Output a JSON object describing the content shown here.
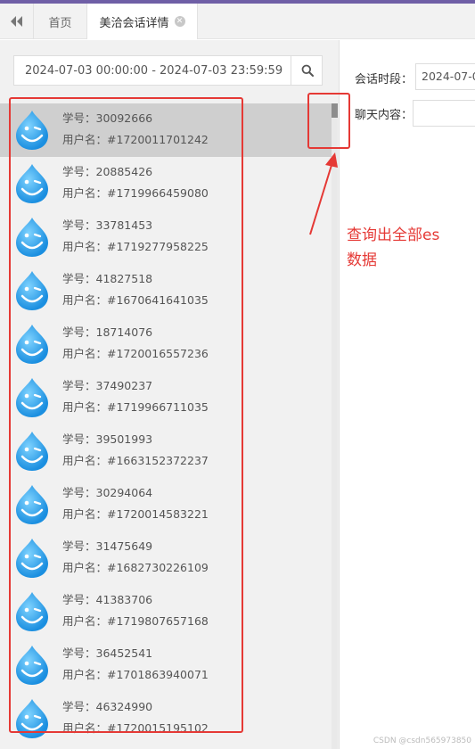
{
  "tabs": {
    "back_icon": "double-left-arrow",
    "home": "首页",
    "active": "美洽会话详情"
  },
  "search": {
    "value": "2024-07-03 00:00:00 - 2024-07-03 23:59:59"
  },
  "list": {
    "items": [
      {
        "id_label": "学号：30092666",
        "user_label": "用户名：#1720011701242"
      },
      {
        "id_label": "学号：20885426",
        "user_label": "用户名：#1719966459080"
      },
      {
        "id_label": "学号：33781453",
        "user_label": "用户名：#1719277958225"
      },
      {
        "id_label": "学号：41827518",
        "user_label": "用户名：#1670641641035"
      },
      {
        "id_label": "学号：18714076",
        "user_label": "用户名：#1720016557236"
      },
      {
        "id_label": "学号：37490237",
        "user_label": "用户名：#1719966711035"
      },
      {
        "id_label": "学号：39501993",
        "user_label": "用户名：#1663152372237"
      },
      {
        "id_label": "学号：30294064",
        "user_label": "用户名：#1720014583221"
      },
      {
        "id_label": "学号：31475649",
        "user_label": "用户名：#1682730226109"
      },
      {
        "id_label": "学号：41383706",
        "user_label": "用户名：#1719807657168"
      },
      {
        "id_label": "学号：36452541",
        "user_label": "用户名：#1701863940071"
      },
      {
        "id_label": "学号：46324990",
        "user_label": "用户名：#1720015195102"
      }
    ]
  },
  "detail": {
    "period_label": "会话时段：",
    "period_value": "2024-07-0",
    "content_label": "聊天内容：",
    "content_value": ""
  },
  "annotation": {
    "line1": "查询出全部es",
    "line2": "数据"
  },
  "watermark": "CSDN @csdn565973850",
  "colors": {
    "annotation": "#e53935",
    "topbar": "#6f5fa6",
    "selected_row": "#cfcfcf"
  }
}
